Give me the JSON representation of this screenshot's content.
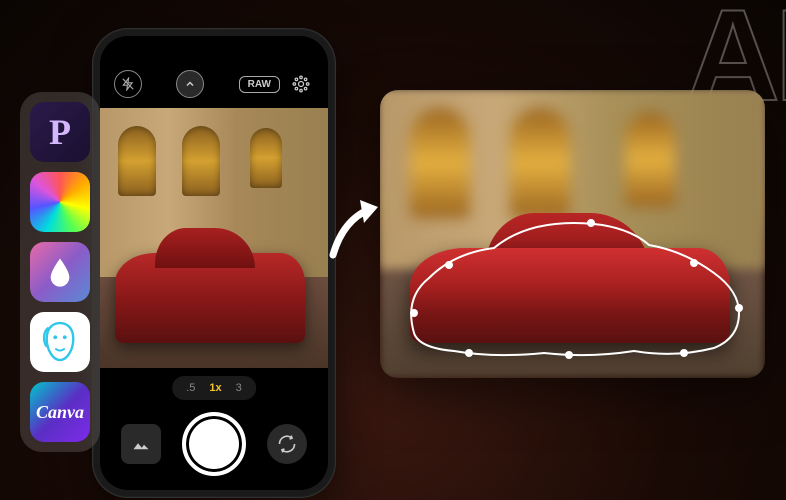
{
  "background_text": "AI",
  "app_dock": {
    "apps": [
      {
        "name": "pixlr",
        "label": "P"
      },
      {
        "name": "color-wheel",
        "label": ""
      },
      {
        "name": "watermark",
        "label": ""
      },
      {
        "name": "facetune",
        "label": ""
      },
      {
        "name": "canva",
        "label": "Canva"
      }
    ]
  },
  "camera": {
    "raw_label": "RAW",
    "zoom_options": [
      ".5",
      "1x",
      "3"
    ],
    "zoom_active": "1x"
  }
}
